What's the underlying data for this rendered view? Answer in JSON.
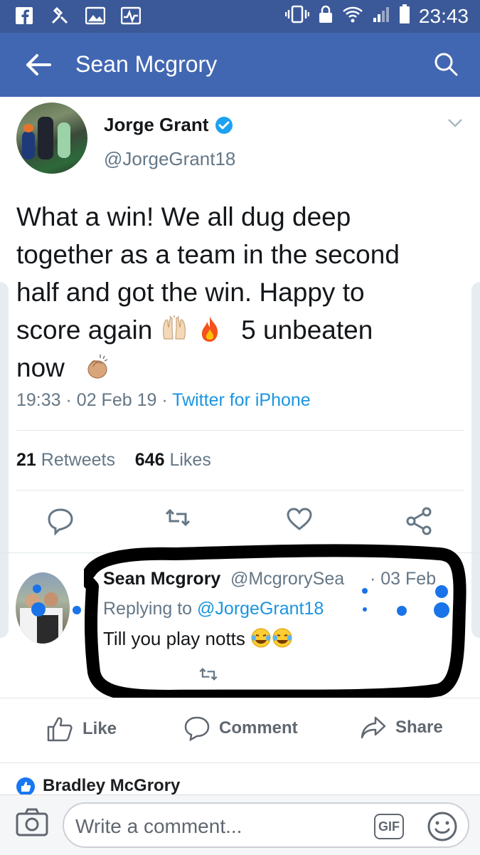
{
  "status_bar": {
    "time": "23:43",
    "icons": [
      "facebook-icon",
      "tools-icon",
      "image-icon",
      "pulse-icon",
      "vibrate-icon",
      "lock-icon",
      "wifi-icon",
      "signal-icon",
      "battery-icon"
    ]
  },
  "app_bar": {
    "title": "Sean Mcgrory",
    "back_icon": "arrow-left-icon",
    "search_icon": "search-icon"
  },
  "tweet": {
    "name": "Jorge Grant",
    "handle": "@JorgeGrant18",
    "text_line1": "What a win! We all dug deep",
    "text_line2": "together as a team in the second",
    "text_line3": "half  and got the win. Happy to",
    "text_line4a": "score again",
    "text_line4b": "5 unbeaten",
    "text_line5": "now",
    "time": "19:33",
    "date": "02 Feb 19",
    "source": "Twitter for iPhone",
    "retweets_count": "21",
    "retweets_label": "Retweets",
    "likes_count": "646",
    "likes_label": "Likes"
  },
  "reply": {
    "name": "Sean Mcgrory",
    "handle": "@McgrorySea",
    "date": "· 03 Feb",
    "replying_prefix": "Replying to",
    "replying_to": "@JorgeGrant18",
    "text": "Till you play notts"
  },
  "facebook_actions": {
    "like": "Like",
    "comment": "Comment",
    "share": "Share"
  },
  "comment_preview": {
    "author": "Bradley McGrory"
  },
  "composer": {
    "placeholder": "Write a comment...",
    "gif": "GIF"
  },
  "colors": {
    "facebook_blue": "#4267b2",
    "twitter_blue": "#1b95e0",
    "marker": "#000000"
  }
}
